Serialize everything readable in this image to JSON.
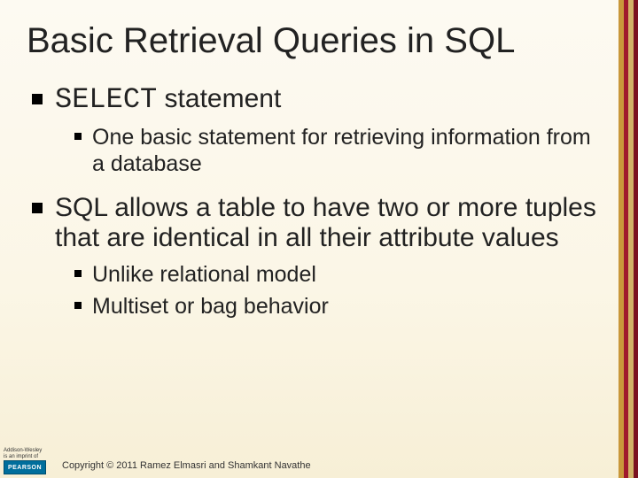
{
  "title": "Basic Retrieval Queries in SQL",
  "bullets": {
    "item1": {
      "select_kw": "SELECT",
      "rest": " statement",
      "sub": {
        "a": "One basic statement for retrieving information from a database"
      }
    },
    "item2": {
      "text": "SQL allows a table to have two or more tuples that are identical in all their attribute values",
      "sub": {
        "a": "Unlike relational model",
        "b": "Multiset or bag behavior"
      }
    }
  },
  "logo": {
    "line1": "Addison-Wesley",
    "line2": "is an imprint of",
    "brand": "PEARSON"
  },
  "copyright": "Copyright © 2011 Ramez Elmasri and Shamkant Navathe"
}
